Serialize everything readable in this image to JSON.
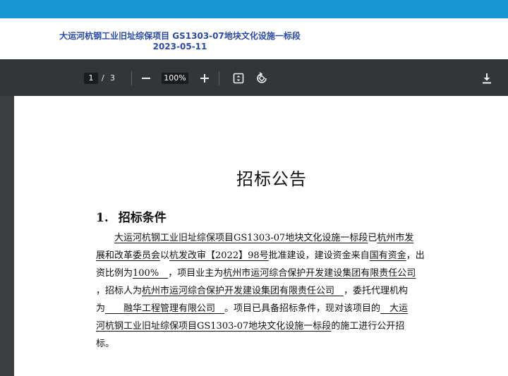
{
  "header": {
    "title_line1": "大运河杭钢工业旧址综保项目 GS1303-07地块文化设施一标段",
    "title_line2": "2023-05-11"
  },
  "toolbar": {
    "current_page": "1",
    "page_separator": "/",
    "total_pages": "3",
    "zoom": "100%"
  },
  "icons": {
    "zoom_out": "minus-icon",
    "zoom_in": "plus-icon",
    "fit_page": "fit-page-icon",
    "rotate": "rotate-icon",
    "download": "download-icon"
  },
  "colors": {
    "top_band": "#1a95d4",
    "toolbar_bg": "#323639",
    "header_text": "#2b4aa8"
  },
  "document": {
    "title": "招标公告",
    "section_number": "1.",
    "section_title": "招标条件",
    "para": {
      "l1": {
        "indent": "　　",
        "a": "大运河杭钢工业旧址综保项目GS1303-07地块文化设施一标段",
        "b": "已",
        "c": "杭州市发"
      },
      "l2": {
        "a": "展和改革委员会",
        "b": "以",
        "c": "杭发改审【2022】98号",
        "d": "批准建设，建设资金来自",
        "e": "国有资金",
        "f": "，出"
      },
      "l3": {
        "a": "资比例为",
        "b": "100%　",
        "c": "，项目业主为",
        "d": "杭州市运河综合保护开发建设集团有限责任公司"
      },
      "l4": {
        "a": "，招标人为",
        "b": "杭州市运河综合保护开发建设集团有限责任公司　",
        "c": "，委托代理机构"
      },
      "l5": {
        "a": "为",
        "b": "　　融华工程管理有限公司　",
        "c": "。项目已具备招标条件，现对该项目的",
        "d": "　大运"
      },
      "l6": {
        "a": "河杭钢工业旧址综保项目GS1303-07地块文化设施一标段",
        "b": "的施工进行公开招"
      },
      "l7": {
        "a": "标。"
      }
    }
  }
}
